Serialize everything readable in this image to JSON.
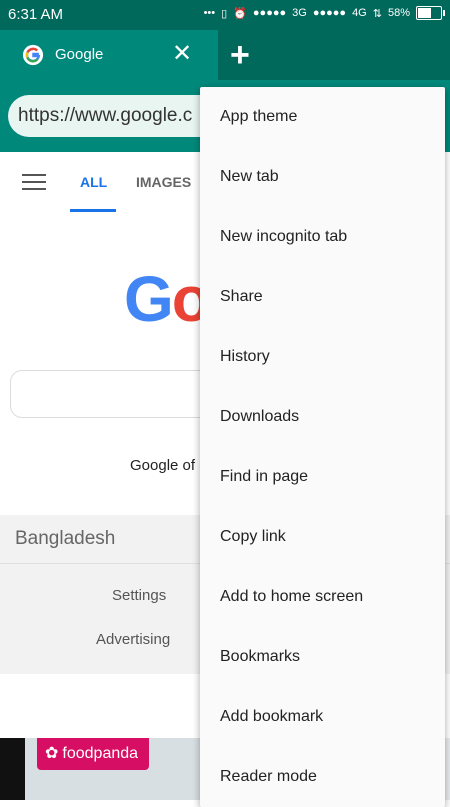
{
  "status_bar": {
    "time": "6:31 AM",
    "network_1": "3G",
    "network_2": "4G",
    "battery_percent": "58%",
    "battery_level": 0.58,
    "icons": [
      "dots-icon",
      "vibrate-icon",
      "alarm-icon"
    ]
  },
  "tab": {
    "title": "Google",
    "close_label": "✕",
    "new_tab_label": "+"
  },
  "url_bar": {
    "value": "https://www.google.c"
  },
  "google_page": {
    "tabs": [
      "ALL",
      "IMAGES"
    ],
    "offered_in": "Google of",
    "country": "Bangladesh",
    "settings": "Settings",
    "advertising": "Advertising",
    "logo_letters": "Go"
  },
  "ad": {
    "brand": "foodpanda"
  },
  "menu": {
    "items": [
      "App theme",
      "New tab",
      "New incognito tab",
      "Share",
      "History",
      "Downloads",
      "Find in page",
      "Copy link",
      "Add to home screen",
      "Bookmarks",
      "Add bookmark",
      "Reader mode"
    ]
  },
  "colors": {
    "toolbar": "#00695c",
    "tab_active": "#00897b",
    "accent": "#1a73e8",
    "foodpanda": "#d70f64"
  }
}
